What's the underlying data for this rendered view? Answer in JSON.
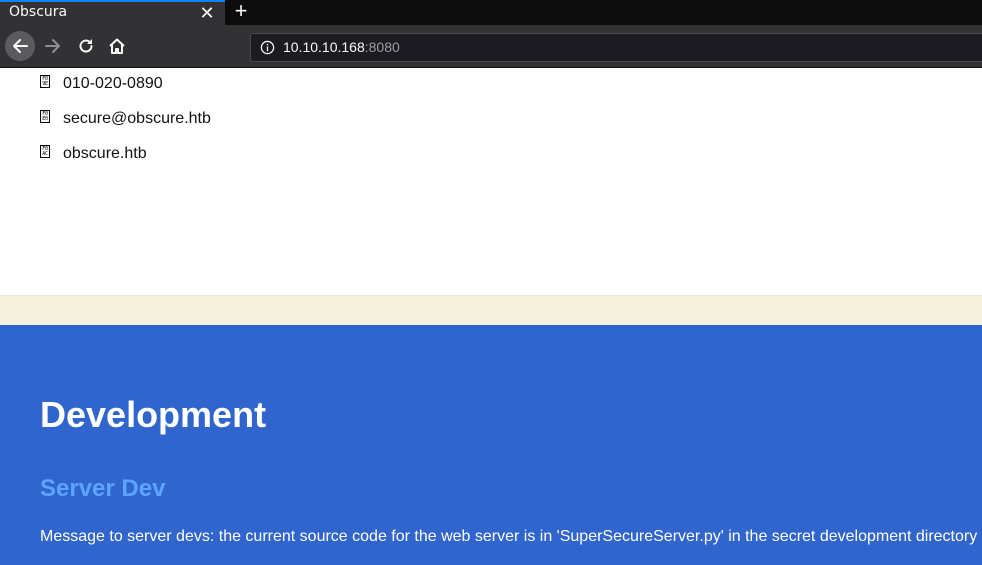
{
  "browser": {
    "tab_title": "Obscura",
    "close_symbol": "✕",
    "new_tab_symbol": "+",
    "url_host": "10.10.10.168",
    "url_port": ":8080"
  },
  "contacts": [
    {
      "icon": "phone-icon",
      "text": "010-020-0890"
    },
    {
      "icon": "email-icon",
      "text": "secure@obscure.htb"
    },
    {
      "icon": "web-icon",
      "text": "obscure.htb"
    }
  ],
  "development": {
    "title": "Development",
    "subtitle": "Server Dev",
    "message": "Message to server devs: the current source code for the web server is in 'SuperSecureServer.py' in the secret development directory"
  },
  "colors": {
    "section_bg": "#3065cd",
    "subtitle": "#5ba4ff",
    "beige": "#f4f2dc"
  }
}
